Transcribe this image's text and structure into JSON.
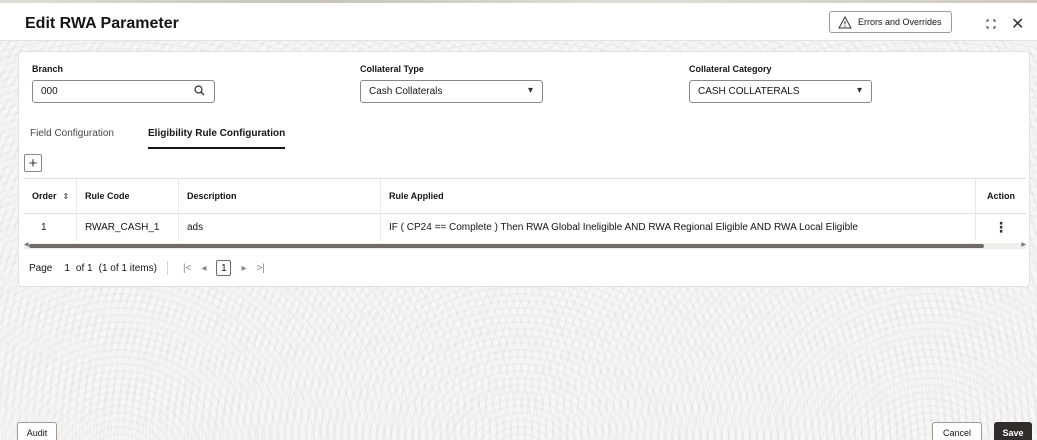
{
  "header": {
    "title": "Edit RWA Parameter",
    "errors_label": "Errors and Overrides",
    "warning_icon": "warning-triangle-icon",
    "expand_icon": "expand-icon",
    "close_icon": "close-icon"
  },
  "form": {
    "branch": {
      "label": "Branch",
      "value": "000",
      "icon": "search-icon"
    },
    "collateral_type": {
      "label": "Collateral Type",
      "value": "Cash Collaterals"
    },
    "collateral_category": {
      "label": "Collateral Category",
      "value": "CASH COLLATERALS"
    }
  },
  "tabs": [
    {
      "label": "Field Configuration",
      "active": false
    },
    {
      "label": "Eligibility Rule Configuration",
      "active": true
    }
  ],
  "table": {
    "columns": [
      "Order",
      "Rule Code",
      "Description",
      "Rule Applied",
      "Action"
    ],
    "rows": [
      {
        "order": "1",
        "rule_code": "RWAR_CASH_1",
        "description": "ads",
        "rule_applied": "IF ( CP24 == Complete ) Then RWA Global Ineligible AND RWA Regional Eligible AND RWA Local Eligible"
      }
    ]
  },
  "pagination": {
    "page_label": "Page",
    "current_page": "1",
    "of_pages": "of 1",
    "items": "(1 of 1 items)",
    "page_button": "1"
  },
  "footer": {
    "audit": "Audit",
    "cancel": "Cancel",
    "save": "Save"
  },
  "colors": {
    "primary_button": "#312d2a",
    "border": "#8c8781"
  }
}
